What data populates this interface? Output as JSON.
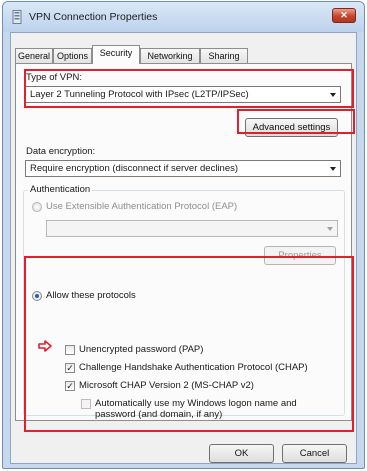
{
  "window": {
    "title": "VPN Connection Properties",
    "close_label": "✕"
  },
  "tabs": [
    {
      "label": "General",
      "active": false
    },
    {
      "label": "Options",
      "active": false
    },
    {
      "label": "Security",
      "active": true
    },
    {
      "label": "Networking",
      "active": false
    },
    {
      "label": "Sharing",
      "active": false
    }
  ],
  "vpn_type": {
    "label": "Type of VPN:",
    "value": "Layer 2 Tunneling Protocol with IPsec (L2TP/IPSec)"
  },
  "advanced_settings_label": "Advanced settings",
  "encryption": {
    "label": "Data encryption:",
    "value": "Require encryption (disconnect if server declines)"
  },
  "authentication": {
    "group_label": "Authentication",
    "eap_radio_label": "Use Extensible Authentication Protocol (EAP)",
    "eap_value": "",
    "properties_label": "Properties",
    "protocols_radio_label": "Allow these protocols",
    "protocols": [
      {
        "label": "Unencrypted password (PAP)",
        "checked": false
      },
      {
        "label": "Challenge Handshake Authentication Protocol (CHAP)",
        "checked": true
      },
      {
        "label": "Microsoft CHAP Version 2 (MS-CHAP v2)",
        "checked": true
      }
    ],
    "auto_logon_line1": "Automatically use my Windows logon name and",
    "auto_logon_line2": "password (and domain, if any)"
  },
  "footer": {
    "ok_label": "OK",
    "cancel_label": "Cancel"
  },
  "colors": {
    "highlight": "#e0202e",
    "window_frame": "#c9dcf2",
    "dialog_bg": "#f0f0f0"
  }
}
